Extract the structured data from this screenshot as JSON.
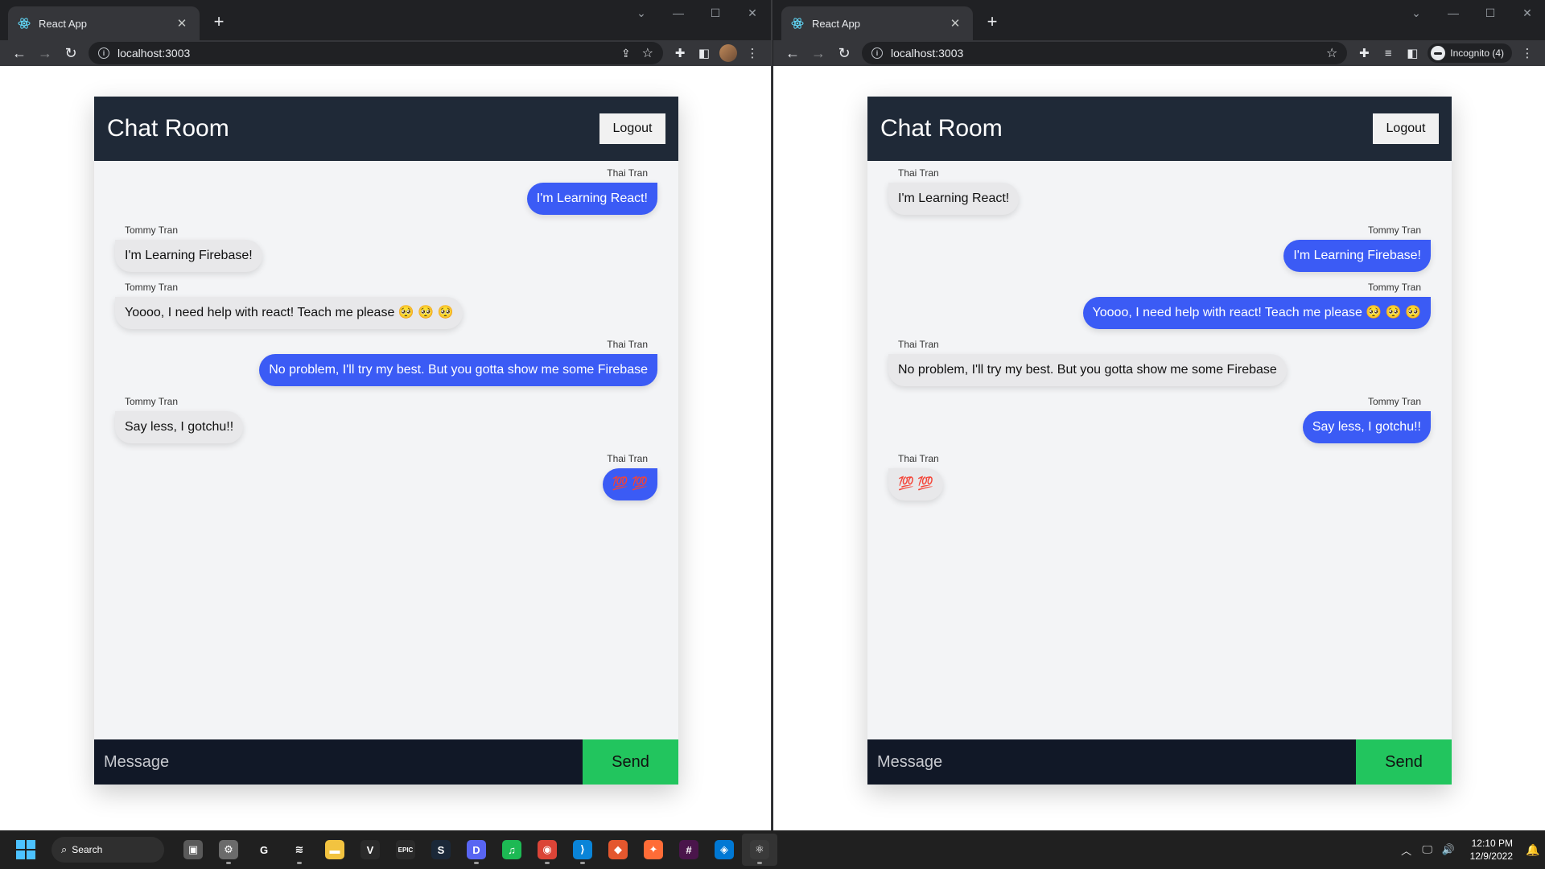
{
  "browser": {
    "tab_title": "React App",
    "new_tab": "+",
    "url": "localhost:3003",
    "incognito_label": "Incognito (4)"
  },
  "app": {
    "title": "Chat Room",
    "logout_label": "Logout",
    "message_placeholder": "Message",
    "send_label": "Send"
  },
  "left_window": {
    "messages": [
      {
        "sender": "Thai Tran",
        "text": "I'm Learning React!",
        "side": "right"
      },
      {
        "sender": "Tommy Tran",
        "text": "I'm Learning Firebase!",
        "side": "left"
      },
      {
        "sender": "Tommy Tran",
        "text": "Yoooo, I need help with react! Teach me please 🥺 🥺 🥺",
        "side": "left"
      },
      {
        "sender": "Thai Tran",
        "text": "No problem, I'll try my best. But you gotta show me some Firebase",
        "side": "right"
      },
      {
        "sender": "Tommy Tran",
        "text": "Say less, I gotchu!!",
        "side": "left"
      },
      {
        "sender": "Thai Tran",
        "text": "💯 💯",
        "side": "right"
      }
    ]
  },
  "right_window": {
    "messages": [
      {
        "sender": "Thai Tran",
        "text": "I'm Learning React!",
        "side": "left"
      },
      {
        "sender": "Tommy Tran",
        "text": "I'm Learning Firebase!",
        "side": "right"
      },
      {
        "sender": "Tommy Tran",
        "text": "Yoooo, I need help with react! Teach me please 🥺 🥺 🥺",
        "side": "right"
      },
      {
        "sender": "Thai Tran",
        "text": "No problem, I'll try my best. But you gotta show me some Firebase",
        "side": "left"
      },
      {
        "sender": "Tommy Tran",
        "text": "Say less, I gotchu!!",
        "side": "right"
      },
      {
        "sender": "Thai Tran",
        "text": "💯 💯",
        "side": "left"
      }
    ]
  },
  "taskbar": {
    "search_label": "Search",
    "time": "12:10 PM",
    "date": "12/9/2022",
    "apps": [
      {
        "name": "task-view",
        "glyph": "▣",
        "color": "#5a5a5a"
      },
      {
        "name": "settings",
        "glyph": "⚙",
        "color": "#6b6b6b"
      },
      {
        "name": "logitech",
        "glyph": "G",
        "color": "#202020"
      },
      {
        "name": "stack-app",
        "glyph": "≋",
        "color": "#202020"
      },
      {
        "name": "file-explorer",
        "glyph": "▬",
        "color": "#f2c340"
      },
      {
        "name": "valorant",
        "glyph": "V",
        "color": "#2a2a2a"
      },
      {
        "name": "epic-games",
        "glyph": "EPIC",
        "color": "#2a2a2a"
      },
      {
        "name": "steam",
        "glyph": "S",
        "color": "#1b2838"
      },
      {
        "name": "discord",
        "glyph": "D",
        "color": "#5865f2"
      },
      {
        "name": "spotify",
        "glyph": "♫",
        "color": "#1db954"
      },
      {
        "name": "chrome",
        "glyph": "◉",
        "color": "#db4437"
      },
      {
        "name": "vscode",
        "glyph": "⟩",
        "color": "#0a84d8"
      },
      {
        "name": "git",
        "glyph": "◆",
        "color": "#e4572e"
      },
      {
        "name": "postman",
        "glyph": "✦",
        "color": "#ff6c37"
      },
      {
        "name": "slack",
        "glyph": "#",
        "color": "#4a154b"
      },
      {
        "name": "azure-data-studio",
        "glyph": "◈",
        "color": "#0078d4"
      },
      {
        "name": "chrome-app-active",
        "glyph": "⚛",
        "color": "#3a3a3a"
      }
    ]
  }
}
